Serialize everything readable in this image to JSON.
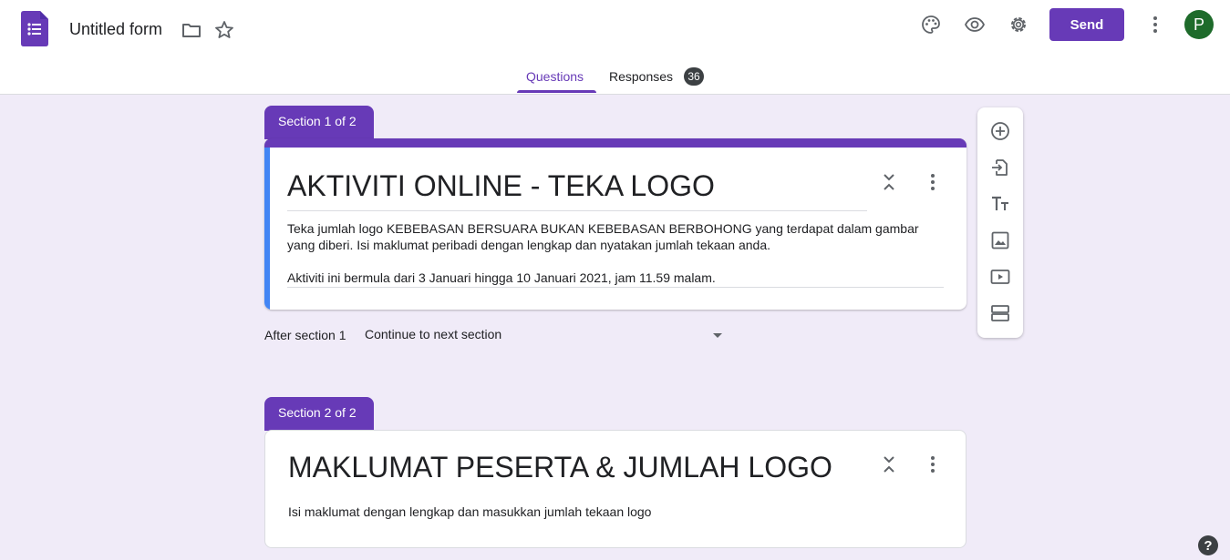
{
  "header": {
    "form_title": "Untitled form",
    "send_label": "Send",
    "avatar_initial": "P",
    "icons": [
      "palette-icon",
      "preview-eye-icon",
      "settings-gear-icon",
      "more-vert-icon",
      "folder-icon",
      "star-icon"
    ]
  },
  "tabs": [
    {
      "label": "Questions",
      "active": true
    },
    {
      "label": "Responses",
      "badge": "36"
    }
  ],
  "sections": [
    {
      "tab_label": "Section 1 of 2",
      "title": "AKTIVITI ONLINE - TEKA LOGO",
      "description_1": "Teka jumlah logo KEBEBASAN BERSUARA BUKAN KEBEBASAN BERBOHONG yang terdapat dalam gambar yang diberi. Isi maklumat peribadi dengan lengkap dan nyatakan jumlah tekaan anda.",
      "description_2": "Aktiviti ini bermula dari 3 Januari hingga 10 Januari 2021, jam 11.59 malam."
    },
    {
      "tab_label": "Section 2 of 2",
      "title": "MAKLUMAT PESERTA & JUMLAH LOGO",
      "description_1": "Isi maklumat dengan lengkap dan masukkan jumlah tekaan logo"
    }
  ],
  "after_section": {
    "label": "After section 1",
    "value": "Continue to next section"
  },
  "toolbar": [
    "add-question-icon",
    "import-questions-icon",
    "add-title-icon",
    "add-image-icon",
    "add-video-icon",
    "add-section-icon"
  ],
  "colors": {
    "accent": "#673ab7",
    "background": "#f0ebf8",
    "focus": "#4285f4",
    "avatar": "#1e6b2b"
  }
}
